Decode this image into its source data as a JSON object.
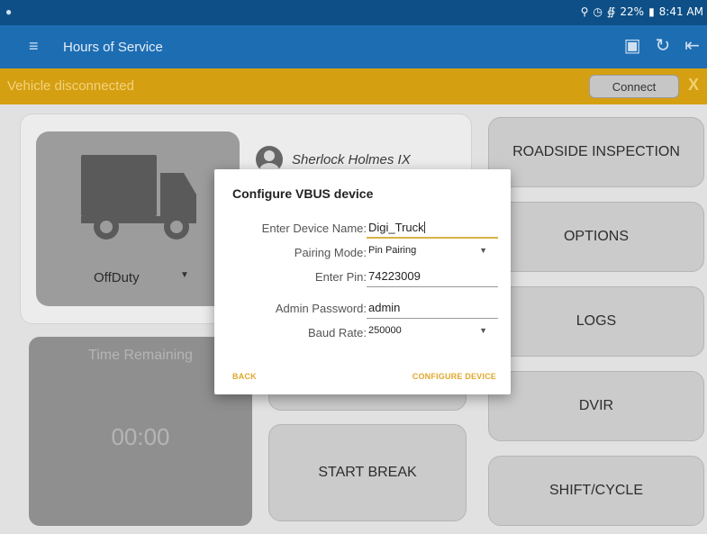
{
  "status_bar": {
    "app_icon": "notification-icon",
    "battery": "22%",
    "time": "8:41 AM",
    "icons": [
      "location-icon",
      "alarm-icon",
      "wifi-icon",
      "battery-icon"
    ]
  },
  "app_bar": {
    "title": "Hours of Service",
    "menu_icon": "hamburger-menu-icon",
    "actions": [
      "device-icon",
      "refresh-icon",
      "logout-icon"
    ]
  },
  "banner": {
    "message": "Vehicle disconnected",
    "connect_label": "Connect",
    "close_label": "X"
  },
  "dashboard": {
    "duty_status": "OffDuty",
    "driver_name": "Sherlock Holmes IX",
    "time_remaining_label": "Time Remaining",
    "time_remaining_value": "00:00",
    "start_break_label": "START BREAK",
    "right_buttons": [
      "ROADSIDE INSPECTION",
      "OPTIONS",
      "LOGS",
      "DVIR",
      "SHIFT/CYCLE"
    ]
  },
  "dialog": {
    "title": "Configure VBUS device",
    "device_name_label": "Enter Device Name:",
    "device_name_value": "Digi_Truck",
    "pairing_mode_label": "Pairing Mode:",
    "pairing_mode_value": "Pin Pairing",
    "pin_label": "Enter Pin:",
    "pin_value": "74223009",
    "admin_password_label": "Admin Password:",
    "admin_password_value": "admin",
    "baud_rate_label": "Baud Rate:",
    "baud_rate_value": "250000",
    "back_label": "BACK",
    "configure_label": "CONFIGURE DEVICE"
  },
  "colors": {
    "status_bar": "#0d4f86",
    "app_bar": "#1d6db3",
    "banner": "#d59f12",
    "dialog_accent": "#e0a82c"
  }
}
